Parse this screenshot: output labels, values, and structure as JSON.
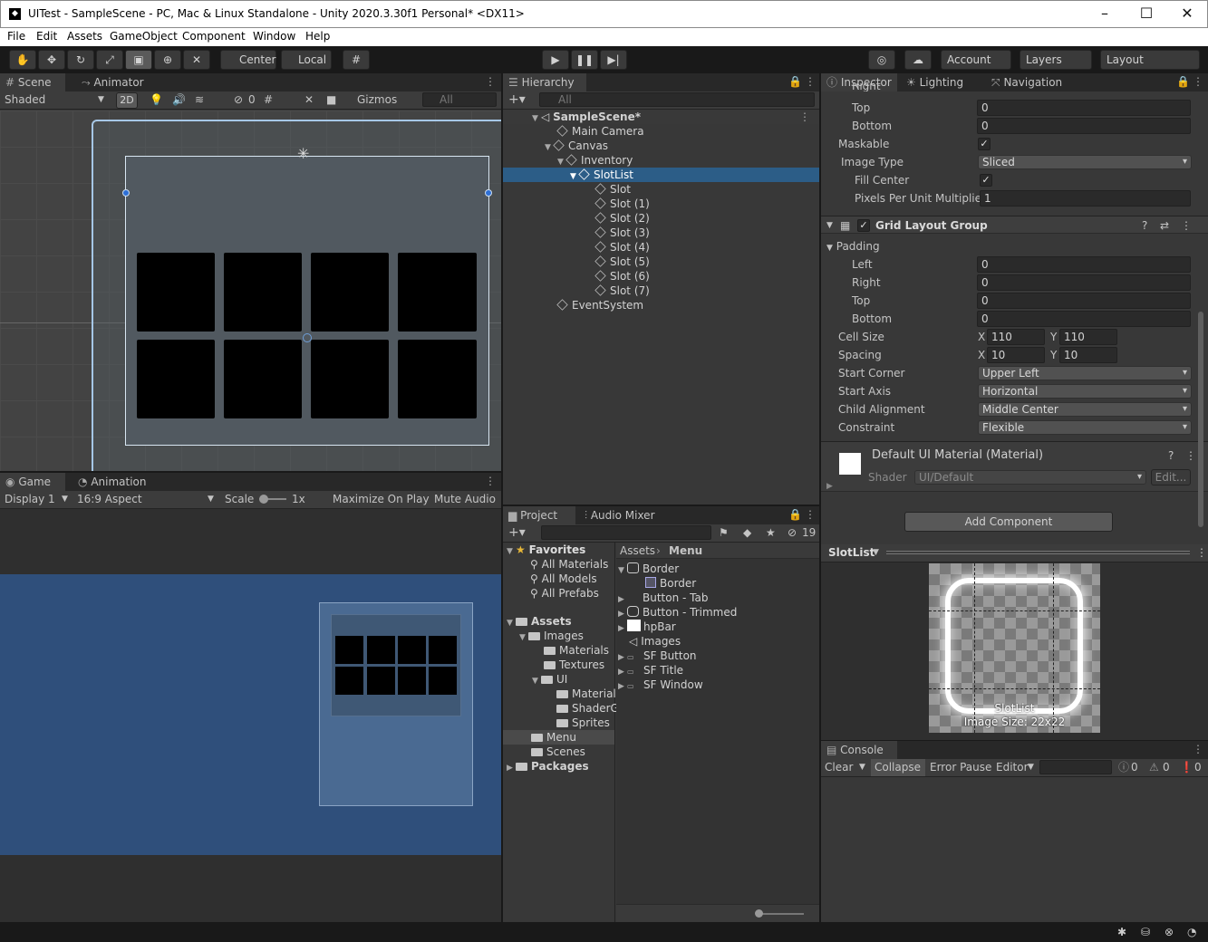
{
  "window": {
    "title": "UITest - SampleScene - PC, Mac & Linux Standalone - Unity 2020.3.30f1 Personal* <DX11>",
    "logo": "unity-logo"
  },
  "menu": [
    "File",
    "Edit",
    "Assets",
    "GameObject",
    "Component",
    "Window",
    "Help"
  ],
  "toolbar": {
    "pivot": "Center",
    "space": "Local",
    "account": "Account",
    "layers": "Layers",
    "layout": "Layout"
  },
  "scene": {
    "tabs": [
      "Scene",
      "Animator"
    ],
    "shading": "Shaded",
    "mode2d": "2D",
    "hidden_count": "0",
    "gizmos": "Gizmos",
    "search": "All"
  },
  "game": {
    "tabs": [
      "Game",
      "Animation"
    ],
    "display": "Display 1",
    "aspect": "16:9 Aspect",
    "scale_label": "Scale",
    "scale_value": "1x",
    "maximize": "Maximize On Play",
    "mute": "Mute Audio"
  },
  "hierarchy": {
    "tab": "Hierarchy",
    "search": "All",
    "items": [
      {
        "label": "SampleScene*",
        "depth": 0
      },
      {
        "label": "Main Camera",
        "depth": 1
      },
      {
        "label": "Canvas",
        "depth": 1
      },
      {
        "label": "Inventory",
        "depth": 2
      },
      {
        "label": "SlotList",
        "depth": 3
      },
      {
        "label": "Slot",
        "depth": 4
      },
      {
        "label": "Slot (1)",
        "depth": 4
      },
      {
        "label": "Slot (2)",
        "depth": 4
      },
      {
        "label": "Slot (3)",
        "depth": 4
      },
      {
        "label": "Slot (4)",
        "depth": 4
      },
      {
        "label": "Slot (5)",
        "depth": 4
      },
      {
        "label": "Slot (6)",
        "depth": 4
      },
      {
        "label": "Slot (7)",
        "depth": 4
      },
      {
        "label": "EventSystem",
        "depth": 1
      }
    ]
  },
  "project": {
    "tabs": [
      "Project",
      "Audio Mixer"
    ],
    "hidden_count": "19",
    "favorites": {
      "title": "Favorites",
      "items": [
        "All Materials",
        "All Models",
        "All Prefabs"
      ]
    },
    "tree": [
      {
        "label": "Assets",
        "depth": 0
      },
      {
        "label": "Images",
        "depth": 1
      },
      {
        "label": "Materials",
        "depth": 2
      },
      {
        "label": "Textures",
        "depth": 2
      },
      {
        "label": "UI",
        "depth": 2
      },
      {
        "label": "Materials",
        "depth": 3
      },
      {
        "label": "ShaderG",
        "depth": 3
      },
      {
        "label": "Sprites",
        "depth": 3
      },
      {
        "label": "Menu",
        "depth": 1
      },
      {
        "label": "Scenes",
        "depth": 1
      },
      {
        "label": "Packages",
        "depth": 0
      }
    ],
    "breadcrumb": [
      "Assets",
      "Menu"
    ],
    "files": [
      "Border",
      "Border",
      "Button - Tab",
      "Button - Trimmed",
      "hpBar",
      "Images",
      "SF Button",
      "SF Title",
      "SF Window"
    ]
  },
  "inspector": {
    "tabs": [
      "Inspector",
      "Lighting",
      "Navigation"
    ],
    "cut_label": "Right",
    "top_rows": [
      {
        "label": "Top",
        "value": "0"
      },
      {
        "label": "Bottom",
        "value": "0"
      }
    ],
    "maskable": "Maskable",
    "image_type_label": "Image Type",
    "image_type": "Sliced",
    "fill_center": "Fill Center",
    "ppu_label": "Pixels Per Unit Multiplier",
    "ppu": "1",
    "grid_title": "Grid Layout Group",
    "padding": "Padding",
    "padding_rows": [
      {
        "label": "Left",
        "value": "0"
      },
      {
        "label": "Right",
        "value": "0"
      },
      {
        "label": "Top",
        "value": "0"
      },
      {
        "label": "Bottom",
        "value": "0"
      }
    ],
    "cell_size": {
      "label": "Cell Size",
      "x": "110",
      "y": "110"
    },
    "spacing": {
      "label": "Spacing",
      "x": "10",
      "y": "10"
    },
    "axis_x": "X",
    "axis_y": "Y",
    "dropdowns": [
      {
        "label": "Start Corner",
        "value": "Upper Left"
      },
      {
        "label": "Start Axis",
        "value": "Horizontal"
      },
      {
        "label": "Child Alignment",
        "value": "Middle Center"
      },
      {
        "label": "Constraint",
        "value": "Flexible"
      }
    ],
    "material": {
      "title": "Default UI Material (Material)",
      "shader_label": "Shader",
      "shader": "UI/Default",
      "edit": "Edit..."
    },
    "add_component": "Add Component",
    "preview": {
      "title": "SlotList",
      "name": "SlotList",
      "size": "Image Size: 22x22"
    }
  },
  "console": {
    "tab": "Console",
    "clear": "Clear",
    "collapse": "Collapse",
    "error_pause": "Error Pause",
    "editor": "Editor",
    "logs": "0",
    "warnings": "0",
    "errors": "0"
  }
}
